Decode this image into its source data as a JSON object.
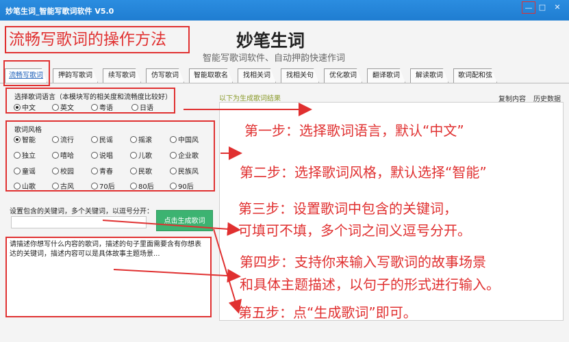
{
  "window": {
    "title": "妙笔生词_智能写歌词软件 V5.0",
    "min": "—",
    "max": "□",
    "close": "✕"
  },
  "header": {
    "howto": "流畅写歌词的操作方法",
    "app_name": "妙笔生词",
    "app_sub": "智能写歌词软件、自动押韵快速作词"
  },
  "tabs": [
    "流畅写歌词",
    "押韵写歌词",
    "续写歌词",
    "仿写歌词",
    "智能取歌名",
    "找相关词",
    "找相关句",
    "优化歌词",
    "翻译歌词",
    "解读歌词",
    "歌词配和弦"
  ],
  "language": {
    "label": "选择歌词语言（本模块写的相关度和流畅度比较好）",
    "options": [
      "中文",
      "英文",
      "粤语",
      "日语"
    ],
    "selected": "中文"
  },
  "style": {
    "label": "歌词风格",
    "options": [
      "智能",
      "流行",
      "民谣",
      "摇滚",
      "中国风",
      "独立",
      "嘻哈",
      "说唱",
      "儿歌",
      "企业歌",
      "童谣",
      "校园",
      "青春",
      "民歌",
      "民族风",
      "山歌",
      "古风",
      "70后",
      "80后",
      "90后"
    ],
    "selected": "智能"
  },
  "keywords": {
    "label": "设置包含的关键词，多个关键词，以逗号分开：",
    "value": ""
  },
  "generate_button": "点击生成歌词",
  "story": {
    "text": "请描述你想写什么内容的歌词，描述的句子里面需要含有你想表达的关键词，描述内容可以是具体故事主题场景..."
  },
  "result": {
    "label": "以下为生成歌词结果",
    "copy": "复制内容",
    "history": "历史数据"
  },
  "steps": {
    "s1": "第一步：选择歌词语言，默认“中文”",
    "s2": "第二步：选择歌词风格，默认选择“智能”",
    "s3a": "第三步：设置歌词中包含的关键词，",
    "s3b": "可填可不填，多个词之间义逗号分开。",
    "s4a": "第四步：支持你来输入写歌词的故事场景",
    "s4b": "和具体主题描述，以句子的形式进行输入。",
    "s5": "第五步：点“生成歌词”即可。"
  },
  "colors": {
    "annotation_red": "#e03030",
    "titlebar_blue": "#1f7dd1",
    "button_green": "#3cb371"
  }
}
